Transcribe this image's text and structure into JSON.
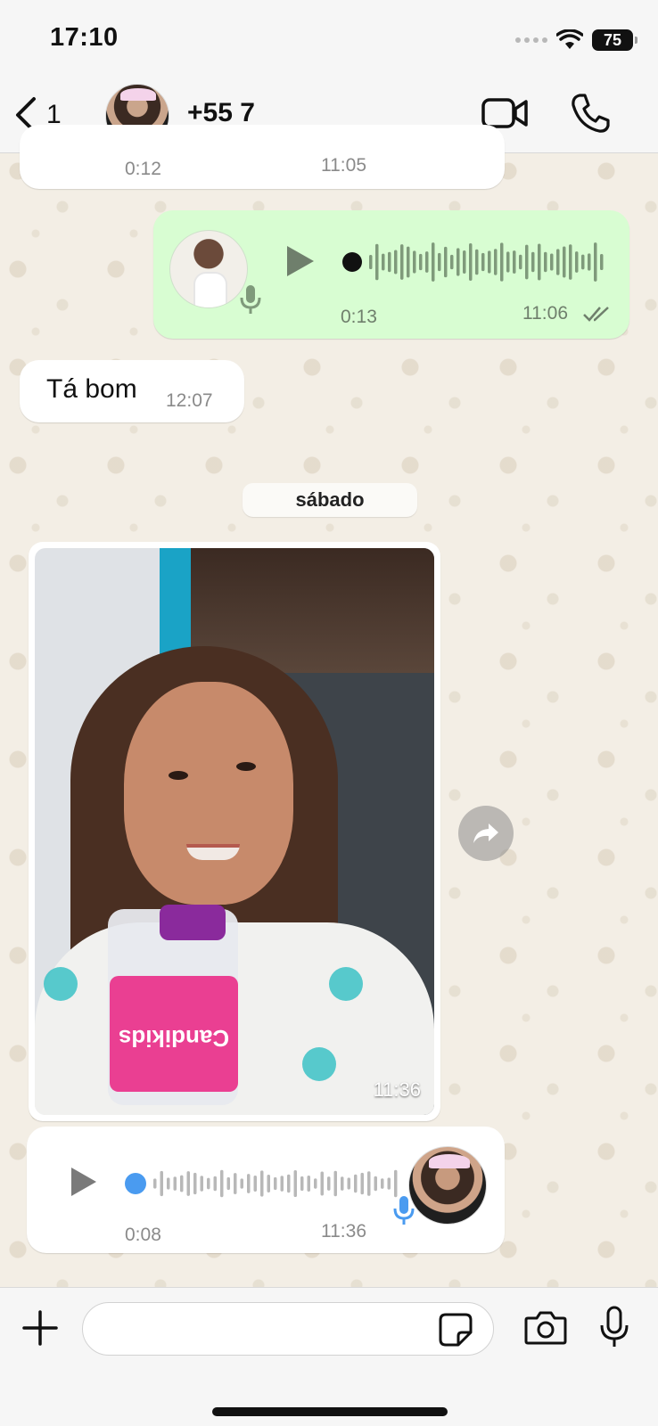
{
  "status_bar": {
    "time": "17:10",
    "battery": "75"
  },
  "header": {
    "back_count": "1",
    "contact_name": "+55 7"
  },
  "messages": {
    "partial_voice": {
      "duration": "0:12",
      "time": "11:05"
    },
    "voice_out": {
      "duration": "0:13",
      "time": "11:06",
      "progress": 0
    },
    "text_in": {
      "text": "Tá bom",
      "time": "12:07"
    },
    "day_separator": "sábado",
    "image_in": {
      "time": "11:36",
      "product_label": "Candikids"
    },
    "voice_in": {
      "duration": "0:08",
      "time": "11:36",
      "progress": 0
    }
  },
  "composer": {
    "placeholder": "",
    "value": ""
  },
  "colors": {
    "outgoing_bubble": "#d8fdd2",
    "incoming_bubble": "#ffffff",
    "wallpaper": "#f3eee5",
    "voice_progress_in": "#4a9bf0",
    "wave_out": "#7f9a7b",
    "wave_in": "#b8b8b8"
  },
  "icons": {
    "back": "chevron-left-icon",
    "video": "video-camera-icon",
    "phone": "phone-icon",
    "play": "play-icon",
    "mic": "microphone-icon",
    "read": "double-check-icon",
    "forward": "forward-arrow-icon",
    "plus": "plus-icon",
    "sticker": "sticker-icon",
    "camera": "camera-icon"
  }
}
